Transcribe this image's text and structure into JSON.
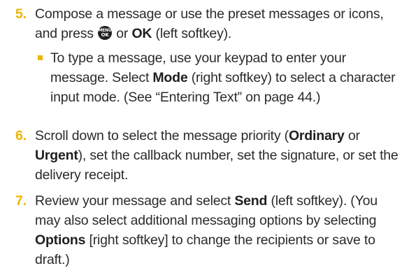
{
  "step5": {
    "number": "5.",
    "text_a": "Compose a message or use the preset messages or icons,",
    "text_b": "and press",
    "menu_icon_top": "MENU",
    "menu_icon_bottom": "OK",
    "text_c": "or",
    "ok_bold": "OK",
    "text_d": "(left softkey).",
    "bullet": {
      "text_a": "To type a message, use your keypad to enter your message. Select",
      "mode_bold": "Mode",
      "text_b": "(right softkey) to select a character input mode. (See “Entering Text” on page 44.)"
    }
  },
  "step6": {
    "number": "6.",
    "text_a": "Scroll down to select the message priority (",
    "ordinary_bold": "Ordinary",
    "text_b": "or",
    "urgent_bold": "Urgent",
    "text_c": "), set the callback number, set the signature, or set the delivery receipt."
  },
  "step7": {
    "number": "7.",
    "text_a": "Review your message and select",
    "send_bold": "Send",
    "text_b": "(left softkey). (You may also select additional messaging options by selecting",
    "options_bold": "Options",
    "text_c": "[right softkey] to change the recipients or save to draft.)"
  },
  "colors": {
    "accent_yellow": "#f0b400",
    "text": "#2b2b2b"
  }
}
